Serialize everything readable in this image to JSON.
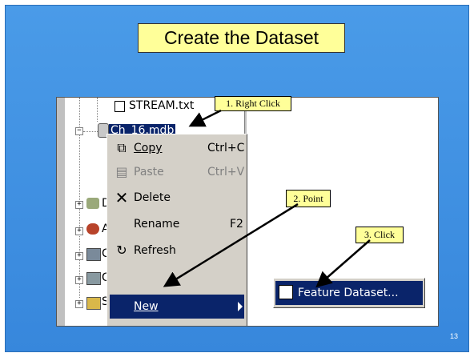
{
  "slide": {
    "title": "Create the Dataset",
    "page_number": "13",
    "colors": {
      "background": "#3b8ee0",
      "title_bg": "#ffff99",
      "callout_bg": "#ffff99",
      "selection": "#0a246a"
    }
  },
  "tree": {
    "stream_file": "STREAM.txt",
    "selected_db": "Ch_16.mdb",
    "items": [
      {
        "label": "Da",
        "icon": "database-connections-icon"
      },
      {
        "label": "Ac",
        "icon": "address-locators-icon"
      },
      {
        "label": "Co",
        "icon": "coordinate-systems-icon"
      },
      {
        "label": "GI",
        "icon": "gis-servers-icon"
      },
      {
        "label": "So",
        "icon": "search-results-icon"
      }
    ]
  },
  "context_menu": {
    "items": [
      {
        "label": "Copy",
        "shortcut": "Ctrl+C",
        "icon": "copy-icon",
        "enabled": true
      },
      {
        "label": "Paste",
        "shortcut": "Ctrl+V",
        "icon": "paste-icon",
        "enabled": false
      },
      {
        "label": "Delete",
        "shortcut": "",
        "icon": "delete-x-icon",
        "enabled": true
      },
      {
        "label": "Rename",
        "shortcut": "F2",
        "icon": "",
        "enabled": true
      },
      {
        "label": "Refresh",
        "shortcut": "",
        "icon": "refresh-icon",
        "enabled": true
      },
      {
        "label": "New",
        "shortcut": "",
        "icon": "",
        "enabled": true,
        "active": true
      }
    ]
  },
  "submenu": {
    "items": [
      {
        "label": "Feature Dataset...",
        "icon": "feature-dataset-icon"
      }
    ]
  },
  "callouts": {
    "step1": "1. Right Click",
    "step2": "2. Point",
    "step3": "3. Click"
  }
}
